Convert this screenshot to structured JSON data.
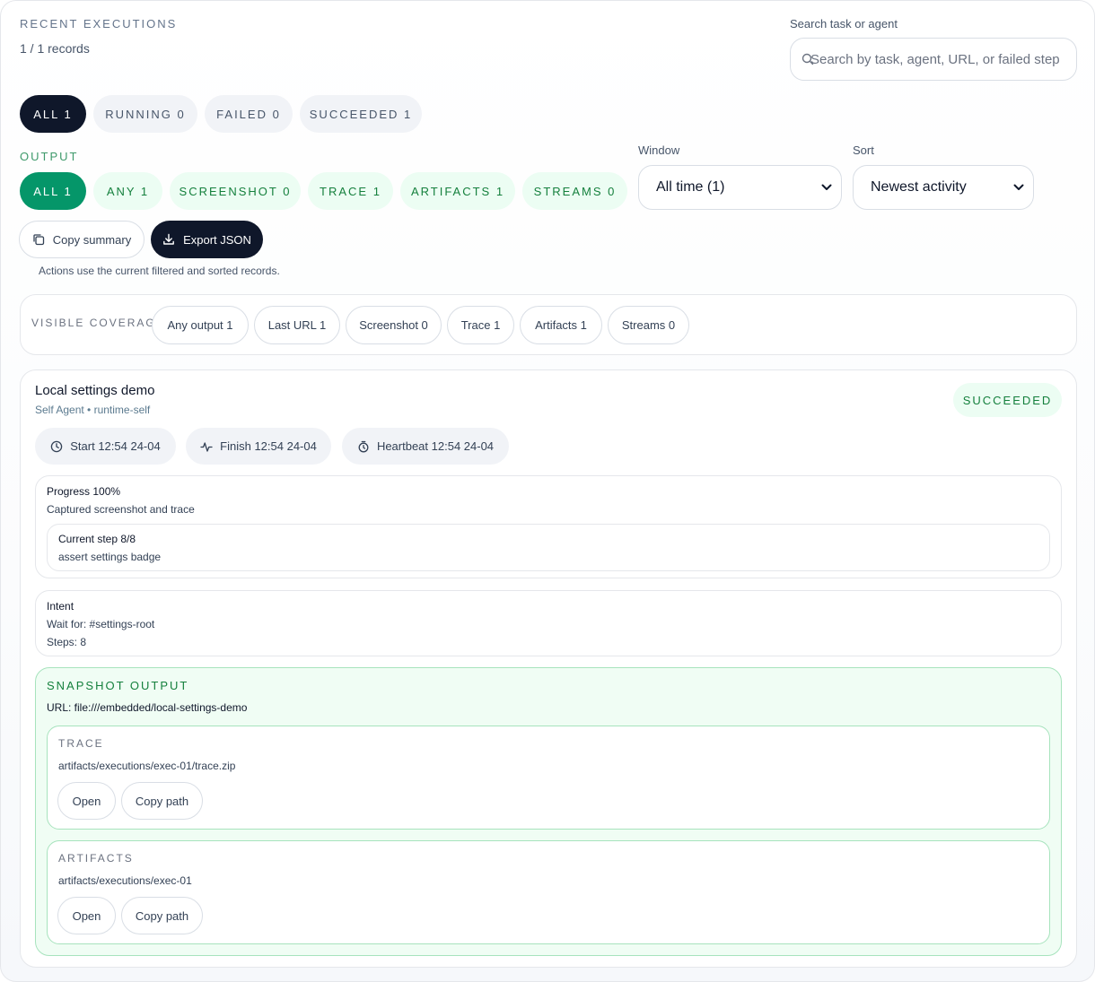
{
  "header": {
    "title": "RECENT EXECUTIONS",
    "records": "1 / 1 records",
    "search_label": "Search task or agent",
    "search_placeholder": "Search by task, agent, URL, or failed step"
  },
  "status_filters": [
    {
      "label": "ALL 1",
      "active": true
    },
    {
      "label": "RUNNING 0",
      "active": false
    },
    {
      "label": "FAILED 0",
      "active": false
    },
    {
      "label": "SUCCEEDED 1",
      "active": false
    }
  ],
  "output": {
    "label": "OUTPUT",
    "filters": [
      {
        "label": "ALL 1",
        "active": true
      },
      {
        "label": "ANY 1",
        "active": false
      },
      {
        "label": "SCREENSHOT 0",
        "active": false
      },
      {
        "label": "TRACE 1",
        "active": false
      },
      {
        "label": "ARTIFACTS 1",
        "active": false
      },
      {
        "label": "STREAMS 0",
        "active": false
      }
    ]
  },
  "window": {
    "label": "Window",
    "value": "All time (1)"
  },
  "sort": {
    "label": "Sort",
    "value": "Newest activity"
  },
  "actions": {
    "copy_label": "Copy summary",
    "export_label": "Export JSON",
    "hint": "Actions use the current filtered and sorted records."
  },
  "coverage": {
    "label": "VISIBLE COVERAGE",
    "chips": [
      "Any output 1",
      "Last URL 1",
      "Screenshot 0",
      "Trace 1",
      "Artifacts 1",
      "Streams 0"
    ]
  },
  "execution": {
    "title": "Local settings demo",
    "subtitle": "Self Agent • runtime-self",
    "status": "SUCCEEDED",
    "start": "Start 12:54 24-04",
    "finish": "Finish 12:54 24-04",
    "heartbeat": "Heartbeat 12:54 24-04",
    "progress": {
      "title": "Progress 100%",
      "detail": "Captured screenshot and trace",
      "step_title": "Current step 8/8",
      "step_detail": "assert settings badge"
    },
    "intent": {
      "title": "Intent",
      "wait": "Wait for: #settings-root",
      "steps": "Steps: 8"
    },
    "snapshot": {
      "label": "SNAPSHOT OUTPUT",
      "url": "URL: file:///embedded/local-settings-demo",
      "trace": {
        "label": "TRACE",
        "path": "artifacts/executions/exec-01/trace.zip",
        "open": "Open",
        "copy": "Copy path"
      },
      "artifacts": {
        "label": "ARTIFACTS",
        "path": "artifacts/executions/exec-01",
        "open": "Open",
        "copy": "Copy path"
      }
    }
  }
}
